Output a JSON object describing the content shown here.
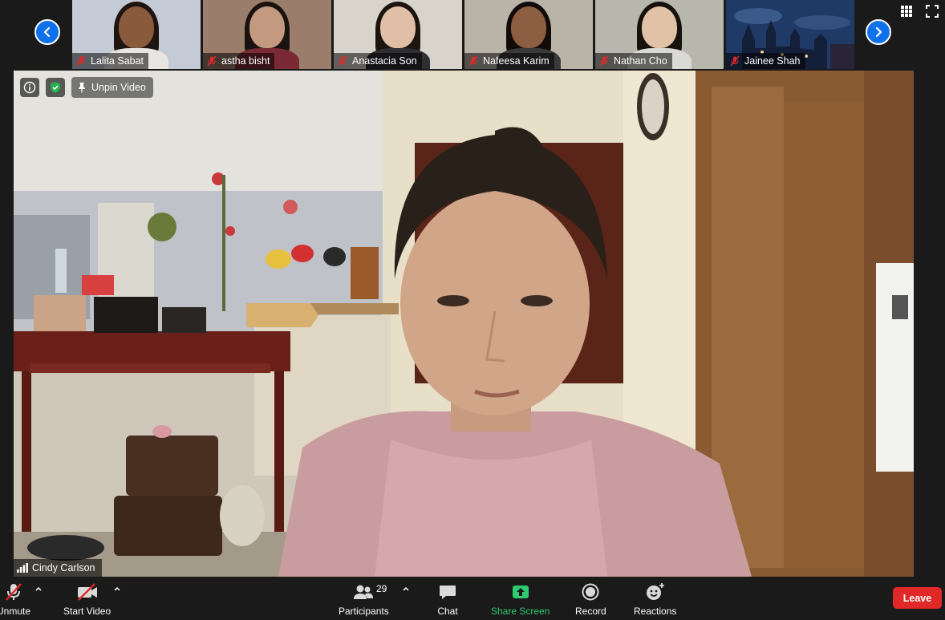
{
  "participants_strip": [
    {
      "name": "Lalita Sabat",
      "bg": "#c4cbd6",
      "skin": "#8a5a3c",
      "hair": "#1e1410",
      "shirt": "#e9e6e2"
    },
    {
      "name": "astha bisht",
      "bg": "#9a7d6a",
      "skin": "#c39a80",
      "hair": "#1a120e",
      "shirt": "#7a2a34"
    },
    {
      "name": "Anastacia Son",
      "bg": "#d8d4cc",
      "skin": "#e0bfa6",
      "hair": "#1c140f",
      "shirt": "#2e2e33"
    },
    {
      "name": "Nafeesa Karim",
      "bg": "#b9b3a8",
      "skin": "#8c5f43",
      "hair": "#120c09",
      "shirt": "#3a3a3a"
    },
    {
      "name": "Nathan Cho",
      "bg": "#b8b7ae",
      "skin": "#e2c2a6",
      "hair": "#16110d",
      "shirt": "#d9d9d6"
    },
    {
      "name": "Jainee Shah",
      "bg": "#1c2f52",
      "skin": "",
      "hair": "",
      "shirt": ""
    }
  ],
  "main_video": {
    "speaker_name": "Cindy Carlson",
    "unpin_label": "Unpin Video"
  },
  "toolbar": {
    "unmute_label": "Unmute",
    "start_video_label": "Start Video",
    "participants_label": "Participants",
    "participants_count": "29",
    "chat_label": "Chat",
    "share_screen_label": "Share Screen",
    "record_label": "Record",
    "reactions_label": "Reactions",
    "leave_label": "Leave"
  },
  "colors": {
    "accent_blue": "#0e71eb",
    "share_green": "#2ecc71",
    "leave_red": "#e02828",
    "muted_red": "#e02828"
  },
  "icons": {
    "nav_left": "chevron-left-icon",
    "nav_right": "chevron-right-icon",
    "gallery": "grid-icon",
    "fullscreen": "fullscreen-icon",
    "info": "info-icon",
    "security": "shield-check-icon",
    "pin": "pin-icon"
  }
}
